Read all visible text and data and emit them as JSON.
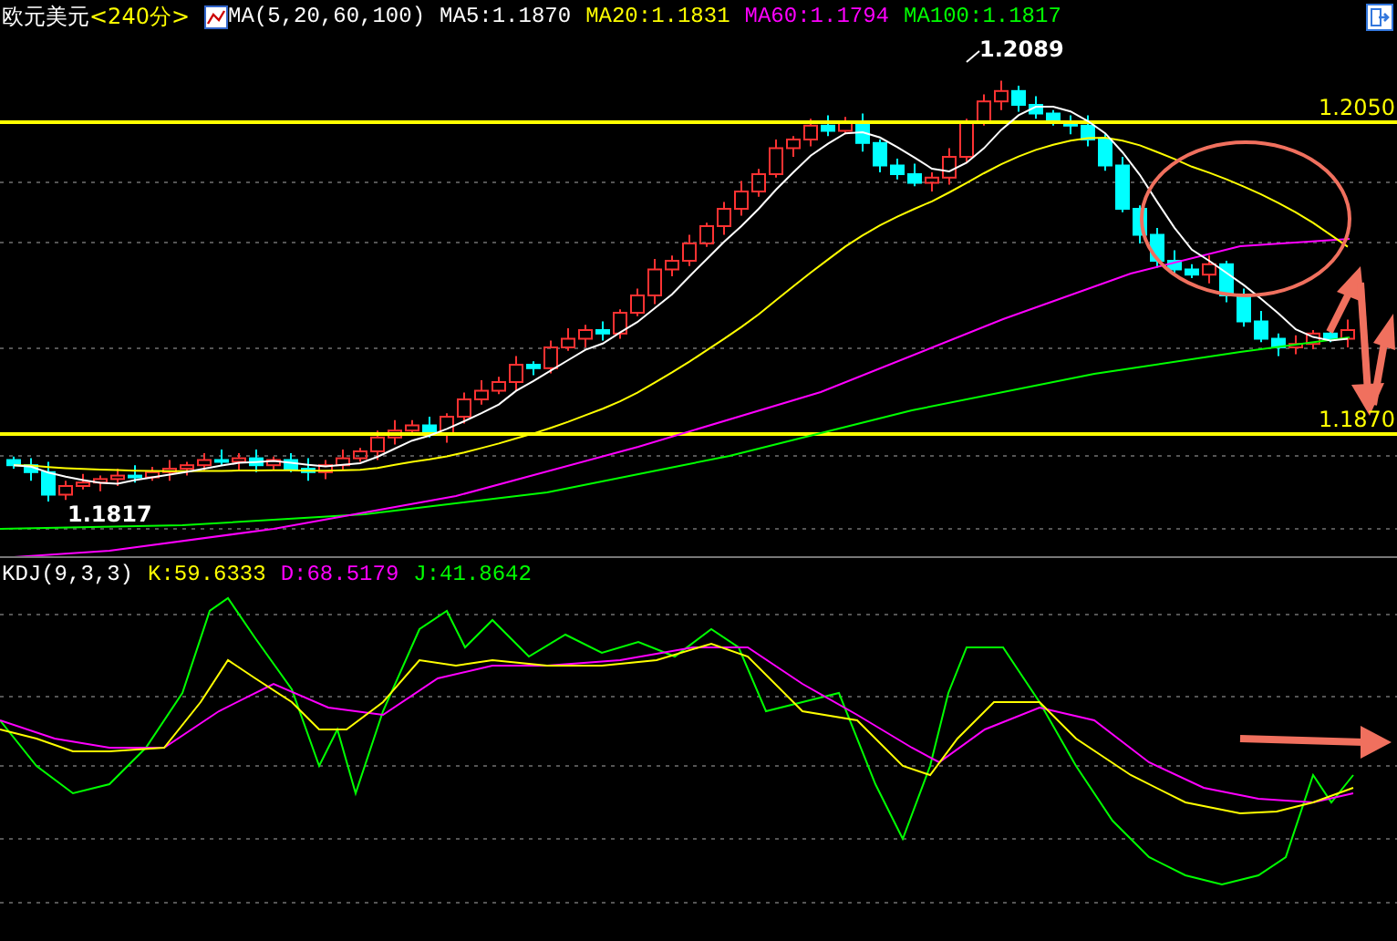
{
  "header": {
    "title": "欧元美元",
    "period": "<240分>",
    "indicator": "MA(5,20,60,100)",
    "values": [
      {
        "label": "MA5:1.1870",
        "color": "#ffffff"
      },
      {
        "label": "MA20:1.1831",
        "color": "#ffff00"
      },
      {
        "label": "MA60:1.1794",
        "color": "#ff00ff"
      },
      {
        "label": "MA100:1.1817",
        "color": "#00ff00"
      }
    ]
  },
  "main_chart": {
    "high_label": "1.2089",
    "low_label": "1.1817",
    "levels": [
      "1.2050",
      "1.1870"
    ]
  },
  "kdj": {
    "indicator": "KDJ(9,3,3)",
    "values": [
      {
        "label": "K:59.6333",
        "color": "#ffff00"
      },
      {
        "label": "D:68.5179",
        "color": "#ff00ff"
      },
      {
        "label": "J:41.8642",
        "color": "#00ff00"
      }
    ]
  }
}
